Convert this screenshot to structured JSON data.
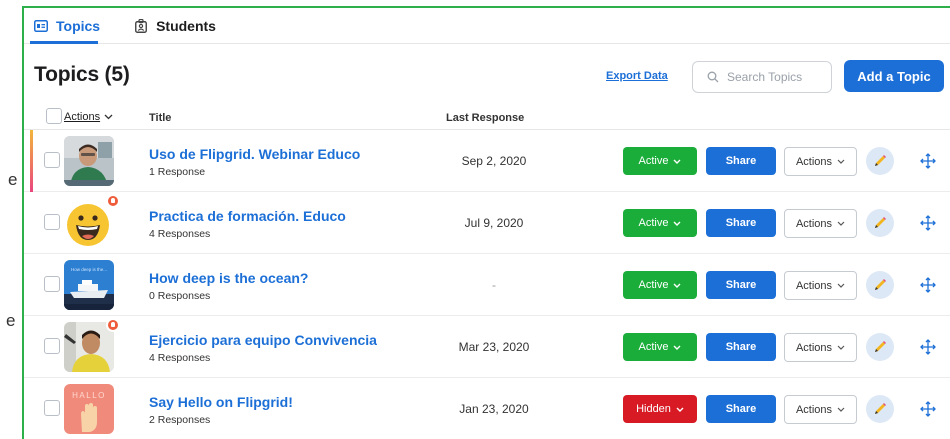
{
  "side": {
    "glyph1": "e",
    "glyph2": "e"
  },
  "tabs": [
    {
      "label": "Topics",
      "icon": "topics-card-icon",
      "active": true
    },
    {
      "label": "Students",
      "icon": "student-badge-icon",
      "active": false
    }
  ],
  "header": {
    "title": "Topics (5)",
    "export_label": "Export Data",
    "search_placeholder": "Search Topics",
    "add_label": "Add a Topic"
  },
  "columns": {
    "actions": "Actions",
    "title": "Title",
    "last_response": "Last Response"
  },
  "row_buttons": {
    "share": "Share",
    "actions": "Actions"
  },
  "topics": [
    {
      "title": "Uso de Flipgrid. Webinar Educo",
      "responses": "1 Response",
      "last_response": "Sep 2, 2020",
      "status": "Active"
    },
    {
      "title": "Practica de formación. Educo",
      "responses": "4 Responses",
      "last_response": "Jul 9, 2020",
      "status": "Active"
    },
    {
      "title": "How deep is the ocean?",
      "responses": "0 Responses",
      "last_response": "-",
      "status": "Active"
    },
    {
      "title": "Ejercicio para equipo Convivencia",
      "responses": "4 Responses",
      "last_response": "Mar 23, 2020",
      "status": "Active"
    },
    {
      "title": "Say Hello on Flipgrid!",
      "responses": "2 Responses",
      "last_response": "Jan 23, 2020",
      "status": "Hidden"
    }
  ],
  "thumb_texts": {
    "ocean": "How deep is the...",
    "hello": "HALLO"
  },
  "colors": {
    "accent": "#1c6fd6",
    "active": "#1bad3a",
    "hidden": "#d71a24",
    "frame": "#2db04a"
  }
}
